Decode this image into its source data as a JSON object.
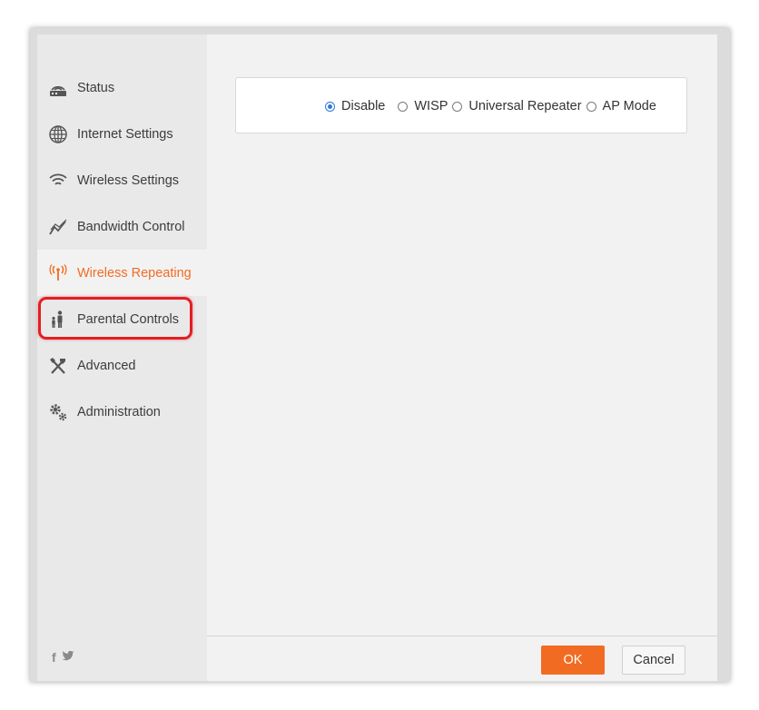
{
  "sidebar": {
    "items": [
      {
        "label": "Status",
        "icon": "router-icon",
        "active": false
      },
      {
        "label": "Internet Settings",
        "icon": "globe-icon",
        "active": false
      },
      {
        "label": "Wireless Settings",
        "icon": "wifi-icon",
        "active": false
      },
      {
        "label": "Bandwidth Control",
        "icon": "bandwidth-graph-icon",
        "active": false
      },
      {
        "label": "Wireless Repeating",
        "icon": "antenna-icon",
        "active": true
      },
      {
        "label": "Parental Controls",
        "icon": "parent-child-icon",
        "active": false
      },
      {
        "label": "Advanced",
        "icon": "tools-icon",
        "active": false
      },
      {
        "label": "Administration",
        "icon": "gears-icon",
        "active": false
      }
    ],
    "social": {
      "facebook": "f",
      "twitter": "🐦"
    }
  },
  "repeating_mode": {
    "options": [
      "Disable",
      "WISP",
      "Universal Repeater",
      "AP Mode"
    ],
    "selected": "Disable"
  },
  "footer": {
    "ok_label": "OK",
    "cancel_label": "Cancel"
  },
  "colors": {
    "accent": "#f26b23",
    "highlight": "#e31e24",
    "radio_selected": "#2c7ad6"
  }
}
